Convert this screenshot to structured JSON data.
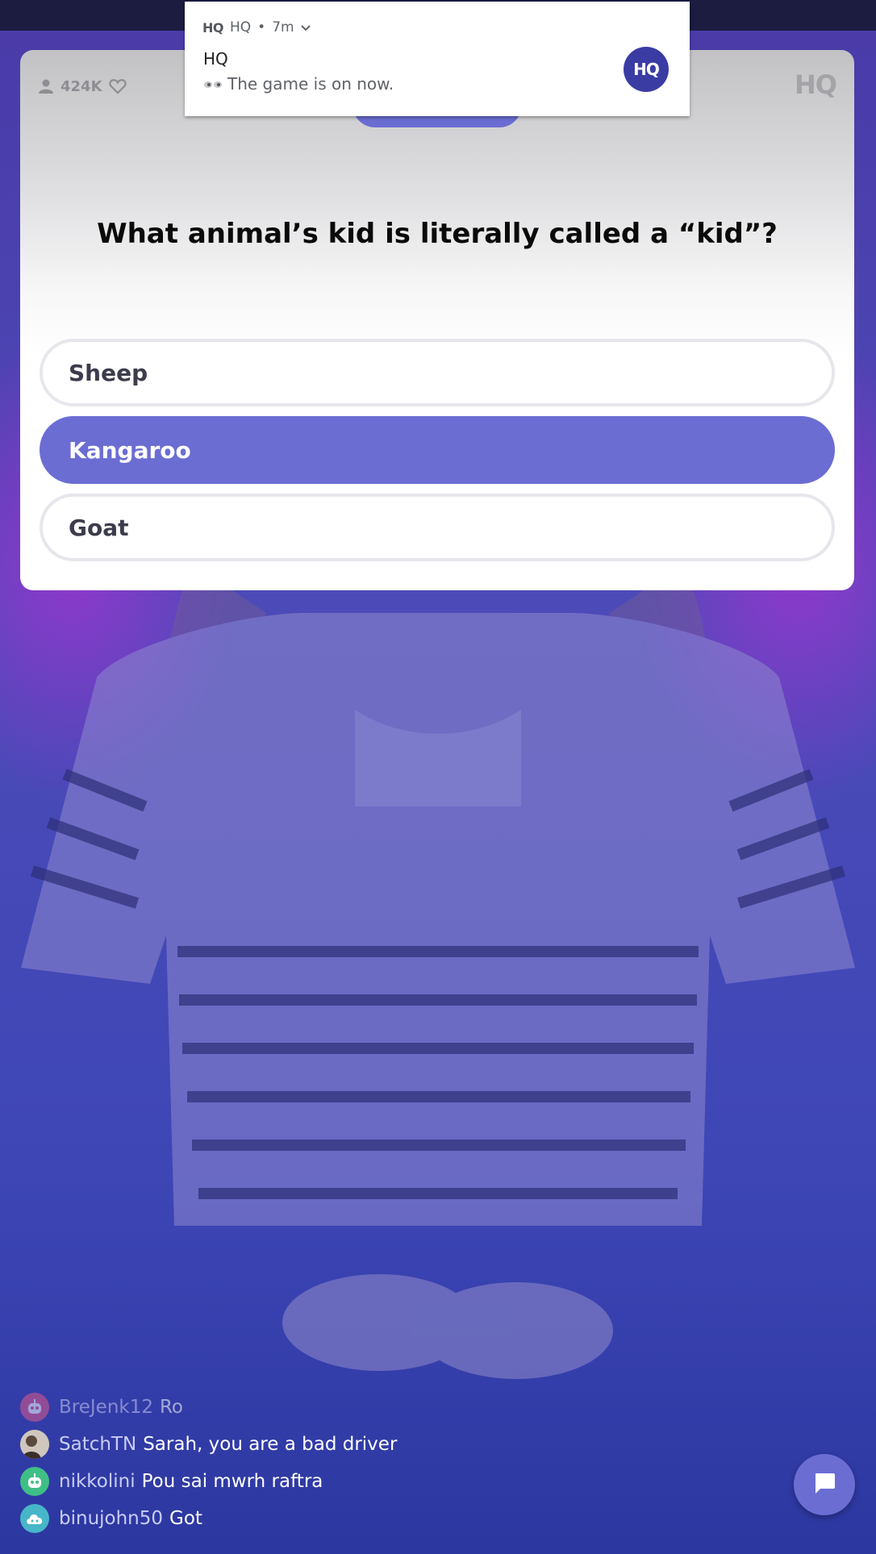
{
  "notification": {
    "app_name": "HQ",
    "separator": "•",
    "time": "7m",
    "title": "HQ",
    "body": "The game is on now.",
    "avatar_text": "HQ"
  },
  "card": {
    "viewer_count": "424K",
    "logo": "HQ",
    "question": "What animal’s kid is literally called a “kid”?",
    "answers": [
      {
        "label": "Sheep",
        "selected": false
      },
      {
        "label": "Kangaroo",
        "selected": true
      },
      {
        "label": "Goat",
        "selected": false
      }
    ]
  },
  "chat": {
    "messages": [
      {
        "user": "BreJenk12",
        "text": "Ro",
        "avatar_color": "#e05a8a",
        "avatar_icon": "robot-icon"
      },
      {
        "user": "SatchTN",
        "text": "Sarah, you are a bad driver",
        "avatar_color": "#9b8f86",
        "avatar_icon": "photo-avatar"
      },
      {
        "user": "nikkolini",
        "text": "Pou sai mwrh raftra",
        "avatar_color": "#3fbf86",
        "avatar_icon": "robot-icon"
      },
      {
        "user": "binujohn50",
        "text": "Got",
        "avatar_color": "#47b6c8",
        "avatar_icon": "cloud-icon"
      }
    ]
  },
  "colors": {
    "accent": "#6b6dd3",
    "answer_border": "#e6e6ec",
    "card_bg": "#ffffff"
  },
  "icons": {
    "viewer": "person-icon",
    "like": "heart-icon",
    "chevron": "chevron-down-icon",
    "eyes": "eyes-icon",
    "chat": "chat-bubble-icon"
  }
}
